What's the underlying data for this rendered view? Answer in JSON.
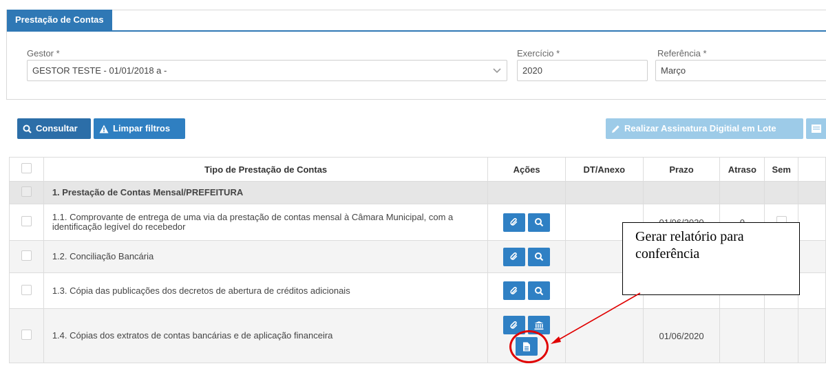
{
  "panel": {
    "title": "Prestação de Contas"
  },
  "filters": {
    "gestor": {
      "label": "Gestor *",
      "value": "GESTOR TESTE - 01/01/2018 a -"
    },
    "exercicio": {
      "label": "Exercício *",
      "value": "2020"
    },
    "referencia": {
      "label": "Referência *",
      "value": "Março"
    }
  },
  "toolbar": {
    "consultar": "Consultar",
    "limpar": "Limpar filtros",
    "assinatura": "Realizar Assinatura Digitial em Lote"
  },
  "table": {
    "headers": {
      "tipo": "Tipo de Prestação de Contas",
      "acoes": "Ações",
      "dt": "DT/Anexo",
      "prazo": "Prazo",
      "atraso": "Atraso",
      "sem": "Sem"
    },
    "group": "1. Prestação de Contas Mensal/PREFEITURA",
    "rows": [
      {
        "tipo": "1.1. Comprovante de entrega de uma via da prestação de contas mensal à Câmara Municipal, com a identificação legível do recebedor",
        "prazo": "01/06/2020",
        "atraso": "0"
      },
      {
        "tipo": "1.2. Conciliação Bancária",
        "prazo": "",
        "atraso": ""
      },
      {
        "tipo": "1.3. Cópia das publicações dos decretos de abertura de créditos adicionais",
        "prazo": "",
        "atraso": ""
      },
      {
        "tipo": "1.4. Cópias dos extratos de contas bancárias e de aplicação financeira",
        "prazo": "01/06/2020",
        "atraso": ""
      }
    ]
  },
  "annotation": {
    "text": "Gerar relatório para conferência"
  },
  "colors": {
    "primary": "#2c6ea8",
    "action": "#2f80c4",
    "disabled": "#9dcbe8",
    "highlight": "#e00000"
  }
}
